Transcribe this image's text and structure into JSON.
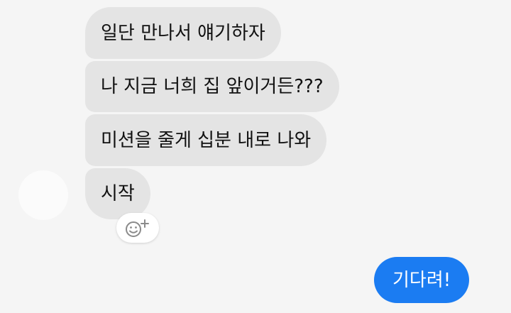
{
  "conversation": {
    "incoming": [
      {
        "text": "일단 만나서 얘기하자"
      },
      {
        "text": "나 지금 너희 집 앞이거든???"
      },
      {
        "text": "미션을 줄게 십분 내로 나와"
      },
      {
        "text": "시작"
      }
    ],
    "reaction_icon": "add-reaction-icon",
    "outgoing": [
      {
        "text": "기다려!"
      }
    ]
  },
  "colors": {
    "background": "#f5f5f5",
    "incoming_bubble": "#e4e4e4",
    "outgoing_bubble": "#1b7cf2"
  }
}
